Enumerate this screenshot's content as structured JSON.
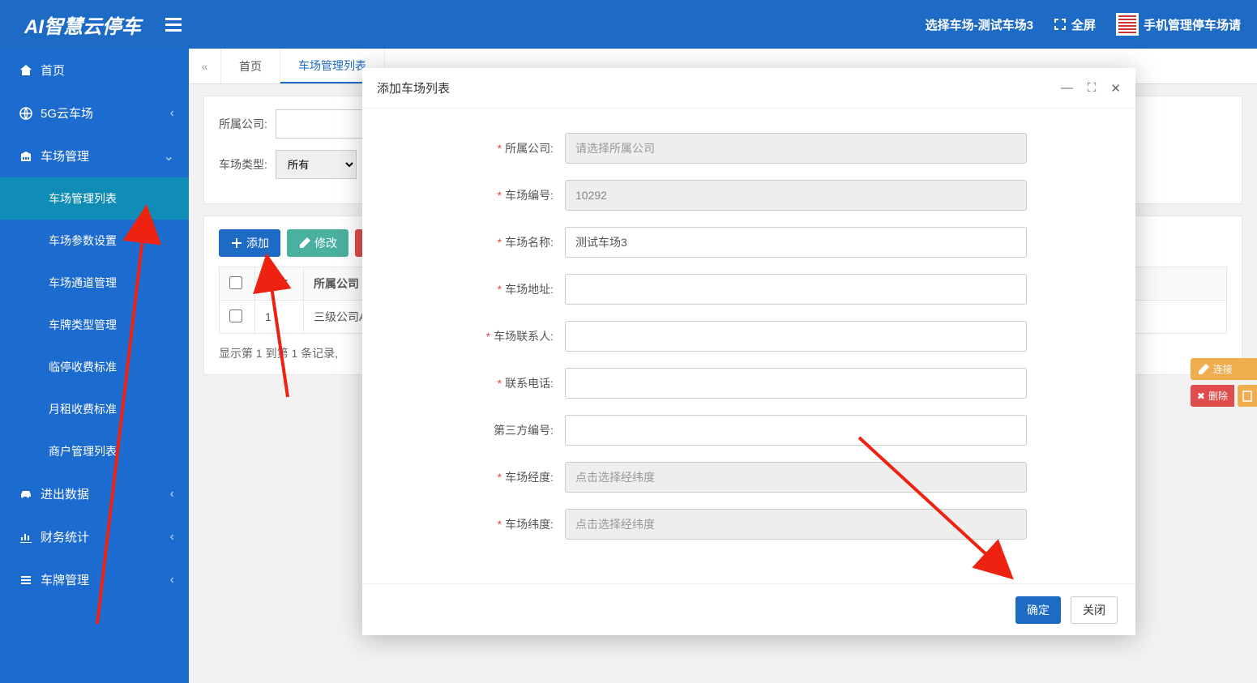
{
  "header": {
    "logo": "AI智慧云停车",
    "select_park": "选择车场-测试车场3",
    "fullscreen": "全屏",
    "mobile_mgmt": "手机管理停车场请"
  },
  "sidebar": {
    "home": "首页",
    "cloud5g": "5G云车场",
    "park_mgmt": "车场管理",
    "sub": {
      "list": "车场管理列表",
      "params": "车场参数设置",
      "channel": "车场通道管理",
      "plate_type": "车牌类型管理",
      "temp_fee": "临停收费标准",
      "month_fee": "月租收费标准",
      "merchant": "商户管理列表"
    },
    "inout": "进出数据",
    "finance": "财务统计",
    "plate": "车牌管理"
  },
  "tabs": {
    "home": "首页",
    "park_list": "车场管理列表"
  },
  "filters": {
    "company_label": "所属公司:",
    "type_label": "车场类型:",
    "type_value": "所有"
  },
  "toolbar": {
    "add": "添加",
    "edit": "修改"
  },
  "table": {
    "cols": {
      "row_no": "行数",
      "company": "所属公司"
    },
    "rows": [
      {
        "row_no": "1",
        "company": "三级公司A"
      }
    ]
  },
  "pagination": "显示第 1 到第 1 条记录,",
  "right_badges": {
    "connect": "连接",
    "delete": "删除"
  },
  "modal": {
    "title": "添加车场列表",
    "labels": {
      "company": "所属公司:",
      "park_no": "车场编号:",
      "park_name": "车场名称:",
      "address": "车场地址:",
      "contact": "车场联系人:",
      "phone": "联系电话:",
      "third_no": "第三方编号:",
      "lng": "车场经度:",
      "lat": "车场纬度:"
    },
    "placeholders": {
      "company": "请选择所属公司",
      "coord": "点击选择经纬度"
    },
    "values": {
      "park_no": "10292",
      "park_name": "测试车场3"
    },
    "footer": {
      "ok": "确定",
      "close": "关闭"
    }
  }
}
